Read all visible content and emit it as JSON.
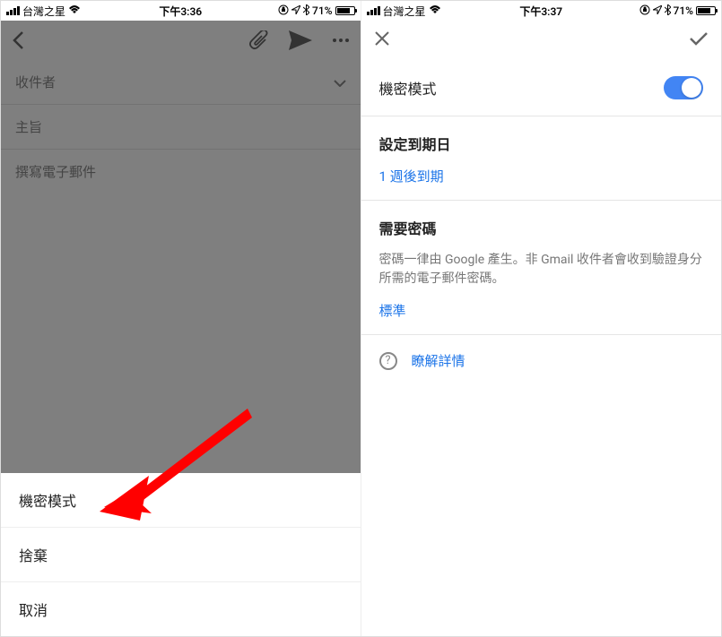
{
  "left": {
    "status": {
      "carrier": "台灣之星",
      "time": "下午3:36",
      "battery": "71%"
    },
    "compose": {
      "recipients_label": "收件者",
      "subject_label": "主旨",
      "body_placeholder": "撰寫電子郵件"
    },
    "action_sheet": {
      "items": [
        {
          "label": "機密模式"
        },
        {
          "label": "捨棄"
        },
        {
          "label": "取消"
        }
      ]
    }
  },
  "right": {
    "status": {
      "carrier": "台灣之星",
      "time": "下午3:37",
      "battery": "71%"
    },
    "settings": {
      "confidential_mode_label": "機密模式",
      "expiry_section_title": "設定到期日",
      "expiry_value": "1 週後到期",
      "passcode_section_title": "需要密碼",
      "passcode_desc": "密碼一律由 Google 產生。非 Gmail 收件者會收到驗證身分所需的電子郵件密碼。",
      "passcode_value": "標準",
      "learn_more": "瞭解詳情"
    }
  }
}
